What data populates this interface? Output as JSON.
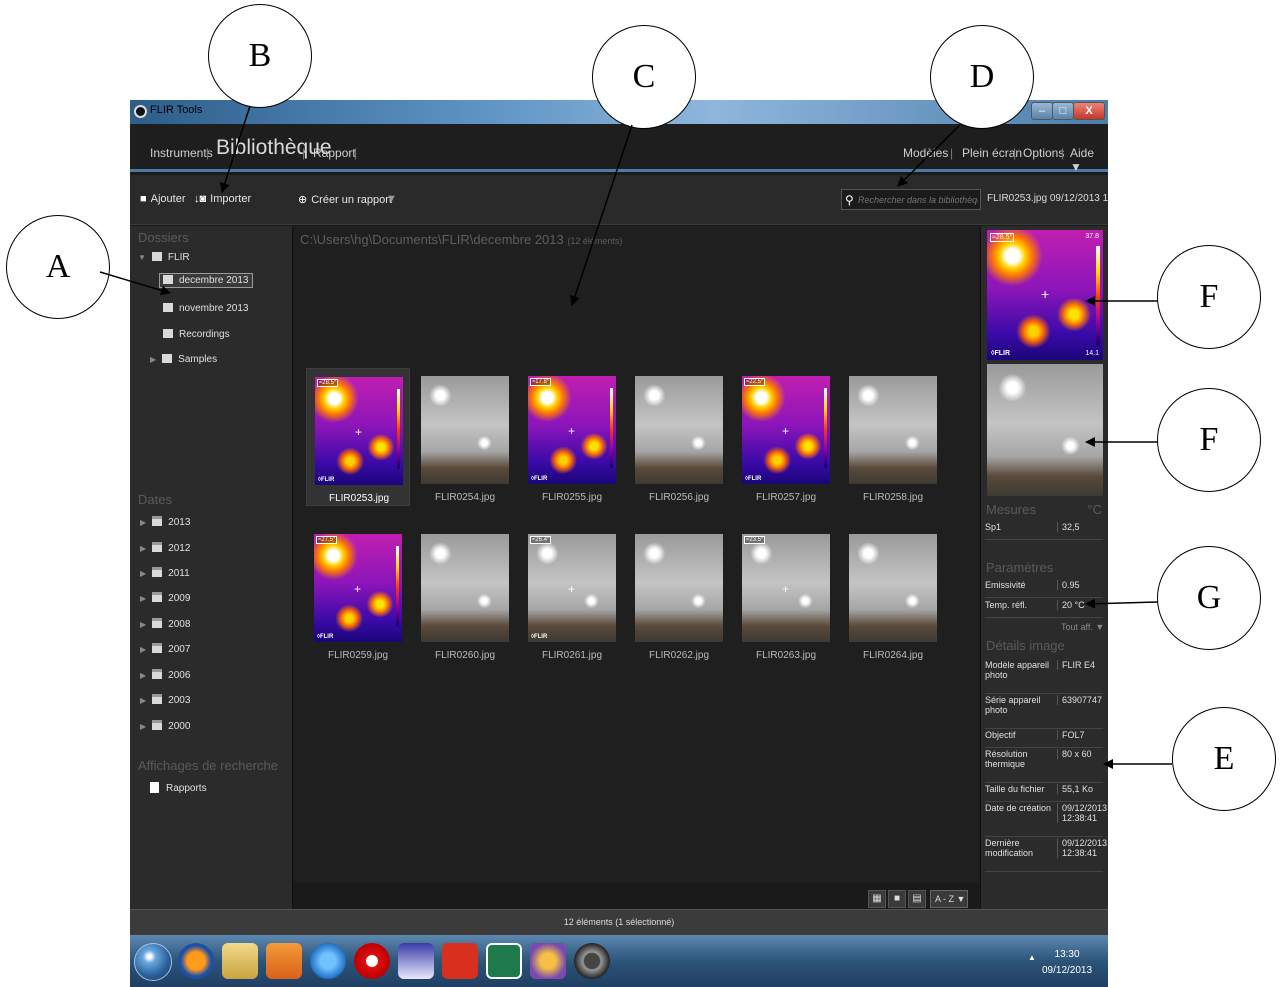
{
  "callouts": {
    "a": "A",
    "b": "B",
    "c": "C",
    "d": "D",
    "e": "E",
    "f1": "F",
    "f2": "F",
    "g": "G"
  },
  "window": {
    "title": "FLIR Tools",
    "min": "–",
    "max": "□",
    "close": "X"
  },
  "nav": {
    "instruments": "Instruments",
    "library": "Bibliothèque",
    "report": "Rapport",
    "models": "Modèles",
    "fullscreen": "Plein écran",
    "options": "Options",
    "help": "Aide ▼",
    "sep": "|"
  },
  "toolbar": {
    "add": "Ajouter",
    "import": "Importer",
    "create_report": "Créer un rapport",
    "dropdown": "▼",
    "search_placeholder": "Rechercher dans la bibliothèque",
    "file_info": "FLIR0253.jpg   09/12/2013 1..."
  },
  "left": {
    "folders_title": "Dossiers",
    "flir": "FLIR",
    "folders": [
      "decembre 2013",
      "novembre 2013",
      "Recordings",
      "Samples"
    ],
    "dates_title": "Dates",
    "years": [
      "2013",
      "2012",
      "2011",
      "2009",
      "2008",
      "2007",
      "2006",
      "2003",
      "2000"
    ],
    "search_views_title": "Affichages de recherche",
    "reports": "Rapports"
  },
  "main": {
    "path": "C:\\Users\\hg\\Documents\\FLIR\\decembre 2013",
    "count": "(12 éléments)",
    "thumbs": [
      {
        "name": "FLIR0253.jpg",
        "tag": "≈28.5°"
      },
      {
        "name": "FLIR0254.jpg",
        "tag": ""
      },
      {
        "name": "FLIR0255.jpg",
        "tag": "≈17.8°"
      },
      {
        "name": "FLIR0256.jpg",
        "tag": ""
      },
      {
        "name": "FLIR0257.jpg",
        "tag": "≈22.5°"
      },
      {
        "name": "FLIR0258.jpg",
        "tag": ""
      },
      {
        "name": "FLIR0259.jpg",
        "tag": "≈27.5°"
      },
      {
        "name": "FLIR0260.jpg",
        "tag": ""
      },
      {
        "name": "FLIR0261.jpg",
        "tag": "≈26.4°"
      },
      {
        "name": "FLIR0262.jpg",
        "tag": ""
      },
      {
        "name": "FLIR0263.jpg",
        "tag": "≈23.5°"
      },
      {
        "name": "FLIR0264.jpg",
        "tag": ""
      }
    ],
    "brand": "◊FLIR",
    "sort": "A - Z ▼"
  },
  "right": {
    "ir_tag": "≈28.5°",
    "ir_max": "37.8",
    "ir_min": "14.1",
    "brand": "◊FLIR",
    "measures_title": "Mesures",
    "unit": "°C",
    "measures": [
      {
        "k": "Sp1",
        "v": "32,5"
      }
    ],
    "params_title": "Paramètres",
    "params": [
      {
        "k": "Emissivité",
        "v": "0.95"
      },
      {
        "k": "Temp. réfl.",
        "v": "20 °C"
      }
    ],
    "show_all": "Tout aff. ▼",
    "details_title": "Détails image",
    "details": [
      {
        "k": "Modèle appareil photo",
        "v": "FLIR E4"
      },
      {
        "k": "Série appareil photo",
        "v": "63907747"
      },
      {
        "k": "Objectif",
        "v": "FOL7"
      },
      {
        "k": "Résolution thermique",
        "v": "80 x 60"
      },
      {
        "k": "Taille du fichier",
        "v": "55,1 Ko"
      },
      {
        "k": "Date de création",
        "v": "09/12/2013 12:38:41"
      },
      {
        "k": "Dernière modification",
        "v": "09/12/2013 12:38:41"
      }
    ]
  },
  "status": "12 éléments  (1 sélectionné)",
  "taskbar": {
    "time": "13:30",
    "date": "09/12/2013",
    "tray": "▲"
  }
}
